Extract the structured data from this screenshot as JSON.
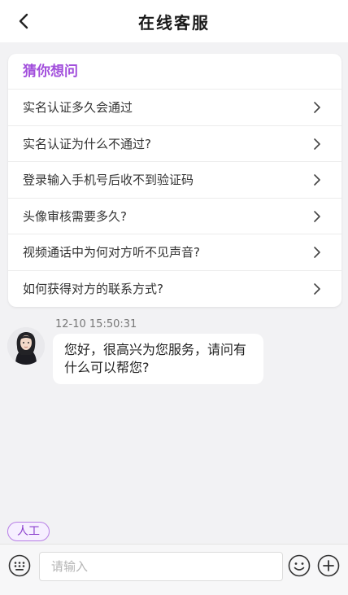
{
  "header": {
    "title": "在线客服",
    "back_icon": "chevron-left-icon"
  },
  "faq": {
    "title": "猜你想问",
    "title_color": "#a24fdc",
    "items": [
      {
        "label": "实名认证多久会通过"
      },
      {
        "label": "实名认证为什么不通过?"
      },
      {
        "label": "登录输入手机号后收不到验证码"
      },
      {
        "label": "头像审核需要多久?"
      },
      {
        "label": "视频通话中为何对方听不见声音?"
      },
      {
        "label": "如何获得对方的联系方式?"
      }
    ]
  },
  "chat": {
    "messages": [
      {
        "timestamp": "12-10 15:50:31",
        "text": "您好，很高兴为您服务，请问有什么可以帮您?"
      }
    ]
  },
  "human_button": {
    "label": "人工",
    "accent": "#8a3fcc"
  },
  "input_bar": {
    "placeholder": "请输入",
    "icons": [
      "keyboard-icon",
      "emoji-icon",
      "plus-icon"
    ]
  }
}
